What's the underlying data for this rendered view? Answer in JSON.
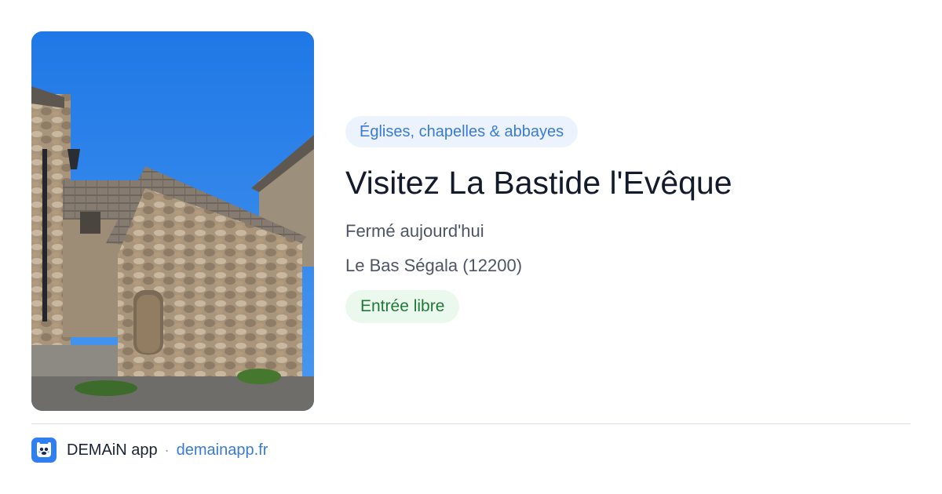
{
  "card": {
    "image_alt": "Bâtiment en pierre de La Bastide l'Evêque",
    "category": "Églises, chapelles & abbayes",
    "title": "Visitez La Bastide l'Evêque",
    "status": "Fermé aujourd'hui",
    "location": "Le Bas Ségala (12200)",
    "entry": "Entrée libre"
  },
  "footer": {
    "logo_icon": "demain-app-logo-icon",
    "app_name": "DEMAiN app",
    "separator": "·",
    "domain": "demainapp.fr"
  },
  "colors": {
    "accent_blue": "#3a7bd5",
    "category_bg": "#edf3fd",
    "entry_green": "#1f7a37",
    "entry_bg": "#ebf8ee",
    "logo_blue": "#2f7ff0"
  }
}
